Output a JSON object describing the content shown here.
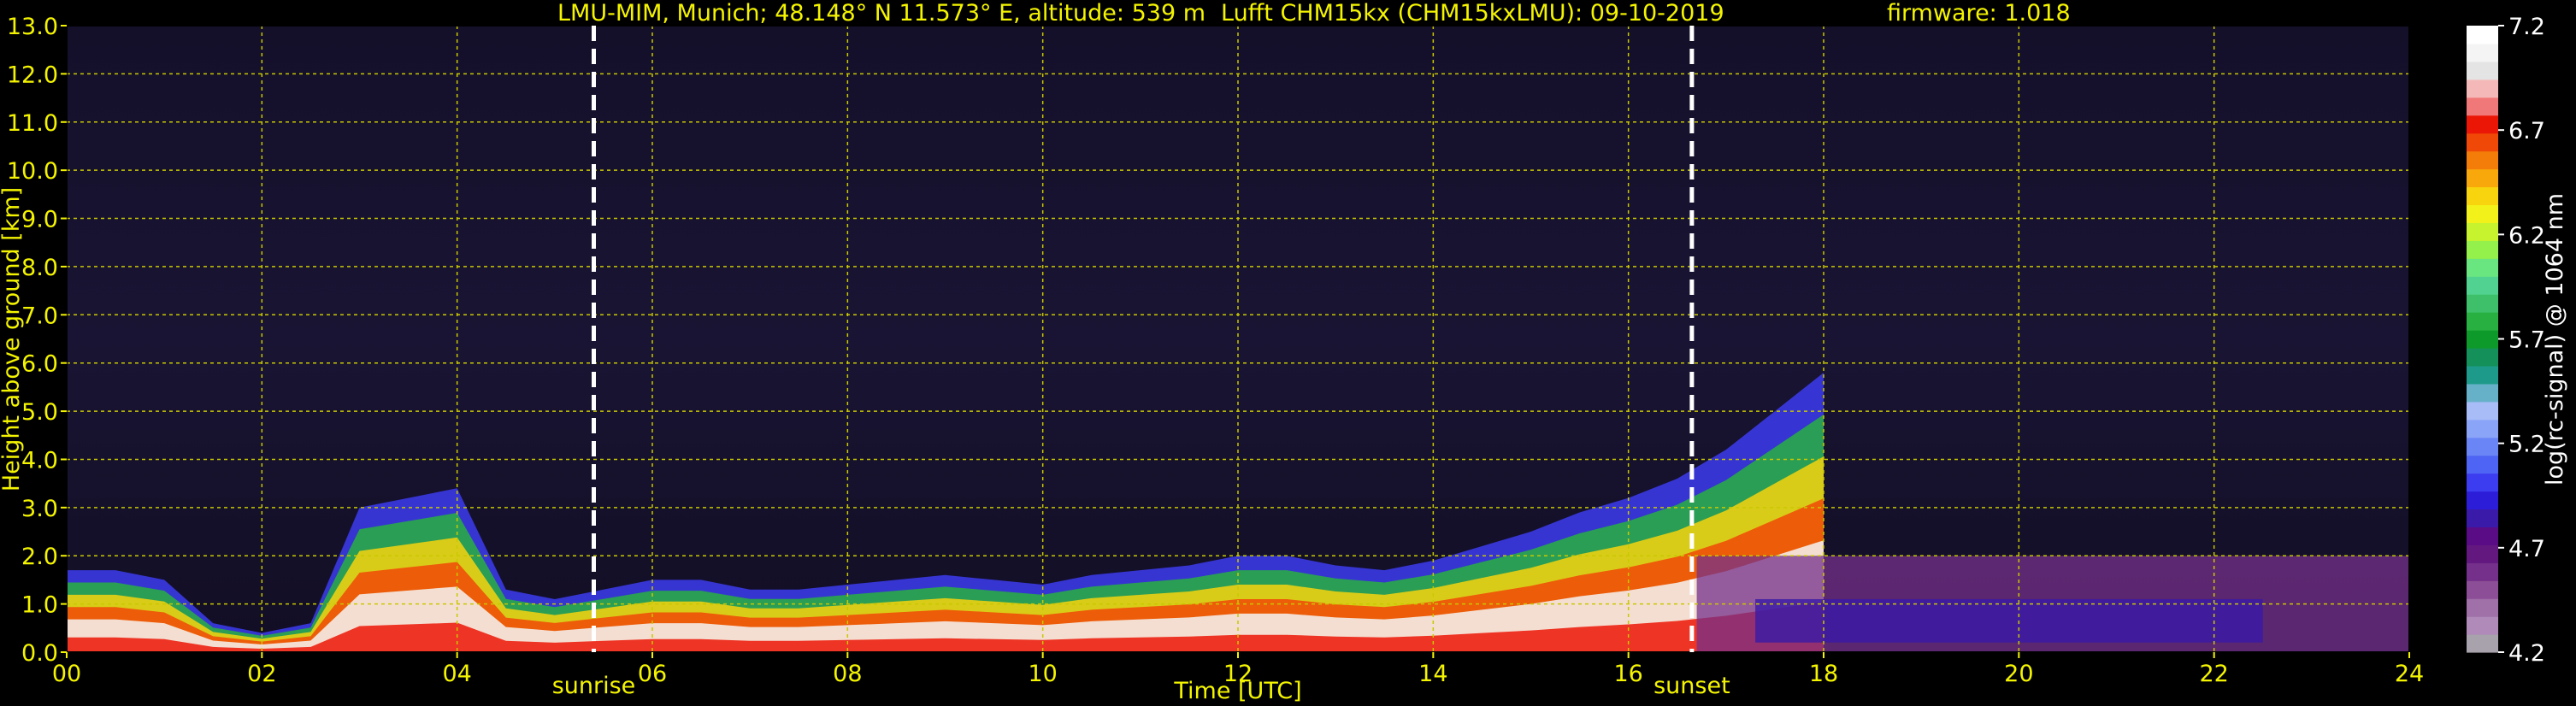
{
  "header": {
    "station": "LMU-MIM, Munich; 48.148° N 11.573° E, altitude: 539 m",
    "instrument": "Lufft CHM15kx (CHM15kxLMU): 09-10-2019",
    "firmware": "firmware: 1.018"
  },
  "chart_data": {
    "type": "heatmap",
    "title": "LMU-MIM, Munich; 48.148° N 11.573° E, altitude: 539 m    Lufft CHM15kx (CHM15kxLMU): 09-10-2019    firmware: 1.018",
    "xlabel": "Time [UTC]",
    "ylabel": "Height above ground [km]",
    "xlim": [
      0,
      24
    ],
    "ylim": [
      0,
      13
    ],
    "x_ticks": [
      "00",
      "02",
      "04",
      "06",
      "08",
      "10",
      "12",
      "14",
      "16",
      "18",
      "20",
      "22",
      "24"
    ],
    "y_ticks": [
      "0.0",
      "1.0",
      "2.0",
      "3.0",
      "4.0",
      "5.0",
      "6.0",
      "7.0",
      "8.0",
      "9.0",
      "10.0",
      "11.0",
      "12.0",
      "13.0"
    ],
    "grid": true,
    "events": [
      {
        "label": "sunrise",
        "x": 5.4
      },
      {
        "label": "sunset",
        "x": 16.65
      }
    ],
    "colorbar": {
      "label": "log(rc-signal) @ 1064 nm",
      "range": [
        4.2,
        7.2
      ],
      "ticks": [
        "4.2",
        "4.7",
        "5.2",
        "5.7",
        "6.2",
        "6.7",
        "7.2"
      ],
      "colors": [
        "#a8a2ac",
        "#b08ab8",
        "#a070a8",
        "#8c4e96",
        "#74308a",
        "#62187e",
        "#5a0c86",
        "#3a1aa8",
        "#2c1ed8",
        "#3c3cf0",
        "#4e64f4",
        "#6a86f6",
        "#8aa4f8",
        "#a8bcf8",
        "#66b0c8",
        "#1e9a8a",
        "#14905a",
        "#0e9a2a",
        "#28b040",
        "#3ec06a",
        "#52d290",
        "#6ae680",
        "#94f04a",
        "#c6f22e",
        "#f2f21a",
        "#f8d40e",
        "#f8a80a",
        "#f47c08",
        "#f04806",
        "#ec1606",
        "#f07878",
        "#f4b8b8",
        "#e4e4e4",
        "#f4f4f4",
        "#ffffff"
      ]
    },
    "cloud_layers": [
      {
        "x": [
          0.0,
          0.5,
          1.0,
          1.5,
          2.0,
          2.5,
          3.0,
          3.5,
          4.0,
          4.5,
          5.0,
          5.5,
          6.0,
          6.5,
          7.0,
          7.5,
          8.0,
          8.5,
          9.0,
          9.5,
          10.0,
          10.5,
          11.0,
          11.5,
          12.0,
          12.5,
          13.0,
          13.5,
          14.0,
          14.5,
          15.0,
          15.5,
          16.0,
          16.5,
          17.0,
          17.5,
          18.0
        ],
        "top": [
          1.7,
          1.7,
          1.5,
          0.6,
          0.4,
          0.6,
          3.0,
          3.2,
          3.4,
          1.3,
          1.1,
          1.3,
          1.5,
          1.5,
          1.3,
          1.3,
          1.4,
          1.5,
          1.6,
          1.5,
          1.4,
          1.6,
          1.7,
          1.8,
          2.0,
          2.0,
          1.8,
          1.7,
          1.9,
          2.2,
          2.5,
          2.9,
          3.2,
          3.6,
          4.2,
          5.0,
          5.8
        ]
      }
    ]
  }
}
